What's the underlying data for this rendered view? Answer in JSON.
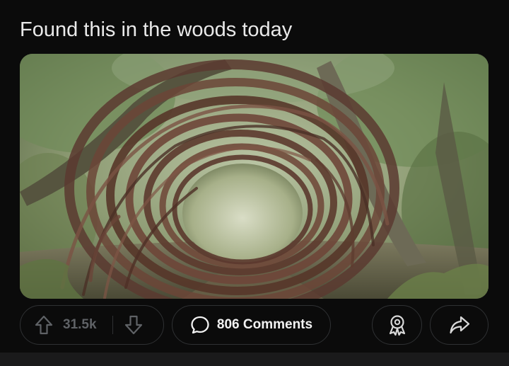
{
  "post": {
    "title": "Found this in the woods today",
    "image_description_icon": "woven-branch-tunnel-photo"
  },
  "actions": {
    "upvote_icon": "arrow-up-outline-icon",
    "vote_count": "31.5k",
    "downvote_icon": "arrow-down-outline-icon",
    "comments_icon": "speech-bubble-icon",
    "comments_label": "806 Comments",
    "award_icon": "award-ribbon-icon",
    "share_icon": "share-arrow-icon"
  },
  "colors": {
    "background": "#0b0b0b",
    "pill_border": "#2f3133",
    "muted_text": "#5f6266",
    "title_text": "#e9e9e9"
  }
}
